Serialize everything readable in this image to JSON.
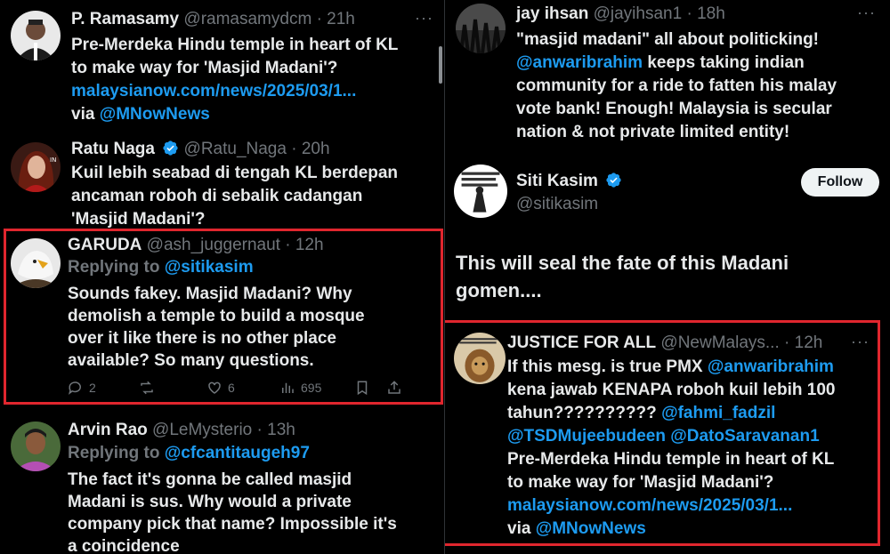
{
  "colors": {
    "link": "#1d9bf0",
    "highlight": "#e0262e",
    "muted": "#71767b",
    "text": "#e7e9ea"
  },
  "left": {
    "t1": {
      "name": "P. Ramasamy",
      "handle": "@ramasamydcm",
      "time": "· 21h",
      "line1": "Pre-Merdeka Hindu temple in heart of KL",
      "line2": "to make way for 'Masjid Madani'?",
      "link": "malaysianow.com/news/2025/03/1...",
      "via": "via ",
      "via_mention": "@MNowNews"
    },
    "t2": {
      "name": "Ratu Naga",
      "handle": "@Ratu_Naga",
      "time": "· 20h",
      "line1": "Kuil lebih seabad di tengah KL berdepan",
      "line2": "ancaman roboh di sebalik cadangan",
      "line3": "'Masjid Madani'?"
    },
    "t3": {
      "name": "GARUDA",
      "handle": "@ash_juggernaut",
      "time": "· 12h",
      "replying": "Replying to ",
      "replying_to": "@sitikasim",
      "line1": "Sounds fakey. Masjid Madani? Why",
      "line2": "demolish a temple to build a mosque",
      "line3": "over it like there is no other place",
      "line4": "available? So many questions.",
      "replies": "2",
      "likes": "6",
      "views": "695"
    },
    "t4": {
      "name": "Arvin Rao",
      "handle": "@LeMysterio",
      "time": "· 13h",
      "replying": "Replying to ",
      "replying_to": "@cfcantitaugeh97",
      "line1": "The fact it's gonna  be called masjid",
      "line2": "Madani is sus. Why would a private",
      "line3": "company pick that name? Impossible it's",
      "line4": "a coincidence"
    }
  },
  "right": {
    "t1": {
      "name": "jay ihsan",
      "handle": "@jayihsan1",
      "time": "· 18h",
      "line1": "\"masjid madani\" all about politicking!",
      "mention1": "@anwaribrahim",
      "line2_rest": " keeps taking indian",
      "line3": "community for a ride to fatten his malay",
      "line4": "vote bank! Enough! Malaysia is secular",
      "line5": "nation & not private limited entity!"
    },
    "t2": {
      "name": "Siti Kasim",
      "handle": "@sitikasim",
      "follow": "Follow",
      "line1": "This will seal the fate of this Madani",
      "line2": "gomen...."
    },
    "t3": {
      "name": "JUSTICE FOR ALL",
      "handle": "@NewMalays...",
      "time": "· 12h",
      "line1_a": "If this mesg. is true PMX ",
      "line1_mention": "@anwaribrahim",
      "line2": "kena jawab KENAPA roboh kuil lebih 100",
      "line3_a": "tahun?????????? ",
      "line3_mention": "@fahmi_fadzil",
      "line4_m1": "@TSDMujeebudeen",
      "line4_m2": "@DatoSaravanan1",
      "line5": "Pre-Merdeka Hindu temple in heart of KL",
      "line6": "to make way for 'Masjid Madani'?",
      "link": "malaysianow.com/news/2025/03/1...",
      "via": "via ",
      "via_mention": "@MNowNews"
    }
  },
  "icons": {
    "more": "more-icon",
    "verified": "verified-badge-icon",
    "reply": "reply-icon",
    "retweet": "retweet-icon",
    "like": "like-icon",
    "views": "views-icon",
    "bookmark": "bookmark-icon",
    "share": "share-icon"
  },
  "more_glyph": "···"
}
